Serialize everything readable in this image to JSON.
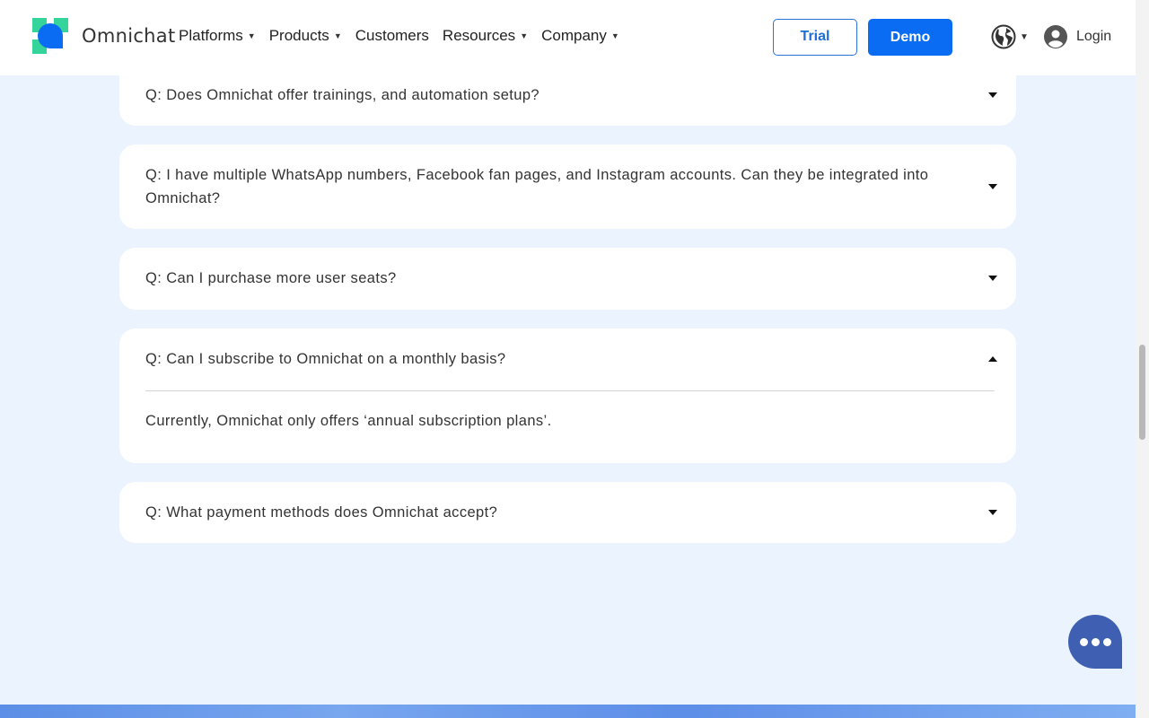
{
  "header": {
    "brand": "Omnichat",
    "nav": [
      {
        "label": "Platforms",
        "has_caret": true
      },
      {
        "label": "Products",
        "has_caret": true
      },
      {
        "label": "Customers",
        "has_caret": false
      },
      {
        "label": "Resources",
        "has_caret": true
      },
      {
        "label": "Company",
        "has_caret": true
      }
    ],
    "trial_label": "Trial",
    "demo_label": "Demo",
    "login_label": "Login",
    "caret": "▼"
  },
  "faq": [
    {
      "question": "Q: Does Omnichat offer trainings, and automation setup?",
      "expanded": false
    },
    {
      "question": "Q: I have multiple WhatsApp numbers, Facebook fan pages, and Instagram accounts. Can they be integrated into Omnichat?",
      "expanded": false
    },
    {
      "question": "Q: Can I purchase more user seats?",
      "expanded": false
    },
    {
      "question": "Q: Can I subscribe to Omnichat on a monthly basis?",
      "expanded": true,
      "answer": "Currently, Omnichat only offers ‘annual subscription plans’."
    },
    {
      "question": "Q: What payment methods does Omnichat accept?",
      "expanded": false
    }
  ],
  "colors": {
    "accent": "#0a6cf2",
    "page_bg": "#ebf3fe",
    "chat_bubble": "#3e5fb2"
  }
}
